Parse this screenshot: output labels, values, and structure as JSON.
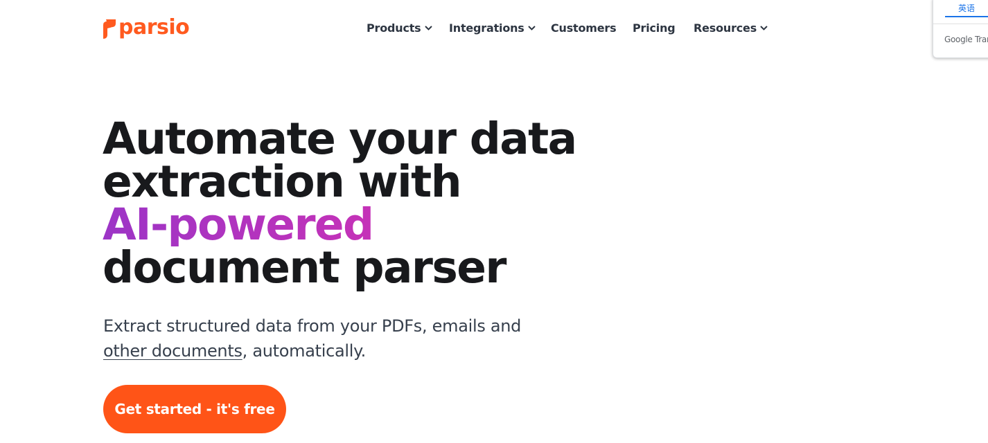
{
  "brand": {
    "name": "parsio",
    "color": "#ff5a1f"
  },
  "nav": {
    "products": "Products",
    "integrations": "Integrations",
    "customers": "Customers",
    "pricing": "Pricing",
    "resources": "Resources"
  },
  "translate": {
    "tab": "英语",
    "brand": "Google Translate"
  },
  "hero": {
    "line1": "Automate your data",
    "line2": "extraction with",
    "line3": "AI-powered",
    "line4": "document parser",
    "sub_before": "Extract structured data from your PDFs, emails and",
    "sub_link": "other documents",
    "sub_after": ", automatically.",
    "cta": "Get started - it's free"
  },
  "colors": {
    "accent": "#ff5417",
    "gradient_start": "#9c35c6",
    "gradient_end": "#d13bb0",
    "text": "#18191c"
  }
}
